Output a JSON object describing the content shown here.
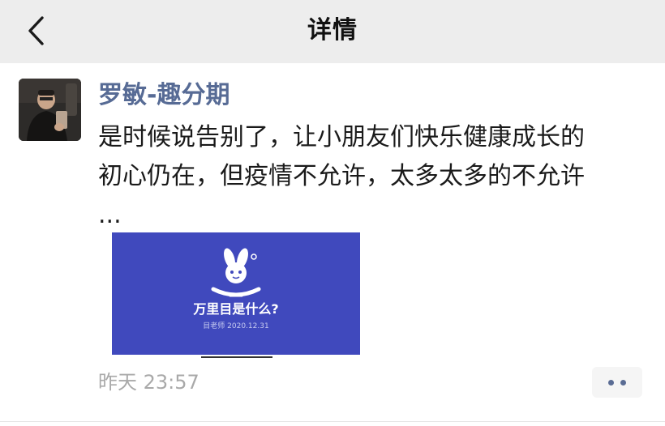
{
  "navbar": {
    "back_icon": "chevron-left-icon",
    "title": "详情"
  },
  "post": {
    "author": "罗敏-趣分期",
    "avatar_icon": "user-avatar-photo",
    "text_lines": [
      "是时候说告别了，让小朋友们快乐健康成长的",
      "初心仍在，但疫情不允许，太多太多的不允许",
      "..."
    ],
    "card": {
      "background": "#4049bd",
      "logo_icon": "rabbit-logo-icon",
      "title": "万里目是什么?",
      "meta": "目老师 2020.12.31"
    },
    "timestamp": "昨天 23:57",
    "more_icon": "more-dots-icon"
  }
}
